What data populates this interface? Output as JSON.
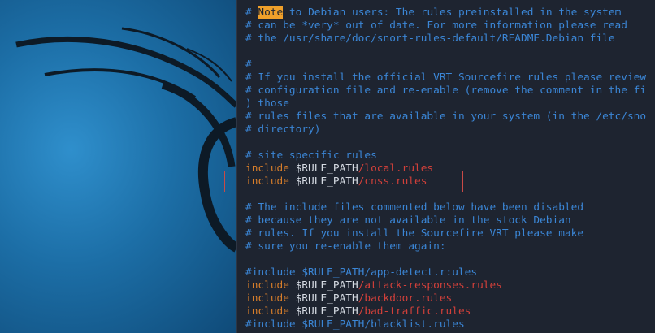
{
  "editor": {
    "lines": [
      {
        "type": "note",
        "prefix": "# ",
        "highlight": "Note",
        "rest": " to Debian users: The rules preinstalled in the system"
      },
      {
        "type": "comment",
        "text": "# can be *very* out of date. For more information please read"
      },
      {
        "type": "comment",
        "text": "# the /usr/share/doc/snort-rules-default/README.Debian file"
      },
      {
        "type": "blank",
        "text": ""
      },
      {
        "type": "comment",
        "text": "#"
      },
      {
        "type": "comment",
        "text": "# If you install the official VRT Sourcefire rules please review"
      },
      {
        "type": "comment",
        "text": "# configuration file and re-enable (remove the comment in the fi"
      },
      {
        "type": "comment",
        "text": ") those"
      },
      {
        "type": "comment",
        "text": "# rules files that are available in your system (in the /etc/sno"
      },
      {
        "type": "comment",
        "text": "# directory)"
      },
      {
        "type": "blank",
        "text": ""
      },
      {
        "type": "comment",
        "text": "# site specific rules"
      },
      {
        "type": "include",
        "kw": "include",
        "var": " $RULE_PATH",
        "path": "/local.rules"
      },
      {
        "type": "include",
        "kw": "include",
        "var": " $RULE_PATH",
        "path": "/cnss.rules"
      },
      {
        "type": "blank",
        "text": ""
      },
      {
        "type": "comment",
        "text": "# The include files commented below have been disabled"
      },
      {
        "type": "comment",
        "text": "# because they are not available in the stock Debian"
      },
      {
        "type": "comment",
        "text": "# rules. If you install the Sourcefire VRT please make"
      },
      {
        "type": "comment",
        "text": "# sure you re-enable them again:"
      },
      {
        "type": "blank",
        "text": ""
      },
      {
        "type": "comment",
        "text": "#include $RULE_PATH/app-detect.r:ules"
      },
      {
        "type": "include",
        "kw": "include",
        "var": " $RULE_PATH",
        "path": "/attack-responses.rules"
      },
      {
        "type": "include",
        "kw": "include",
        "var": " $RULE_PATH",
        "path": "/backdoor.rules"
      },
      {
        "type": "include",
        "kw": "include",
        "var": " $RULE_PATH",
        "path": "/bad-traffic.rules"
      },
      {
        "type": "comment",
        "text": "#include $RULE_PATH/blacklist.rules"
      }
    ]
  },
  "colors": {
    "comment": "#3b86d6",
    "keyword": "#d87e2a",
    "variable": "#d6dbe3",
    "path": "#d2403a",
    "highlight_box": "#c94a46"
  }
}
